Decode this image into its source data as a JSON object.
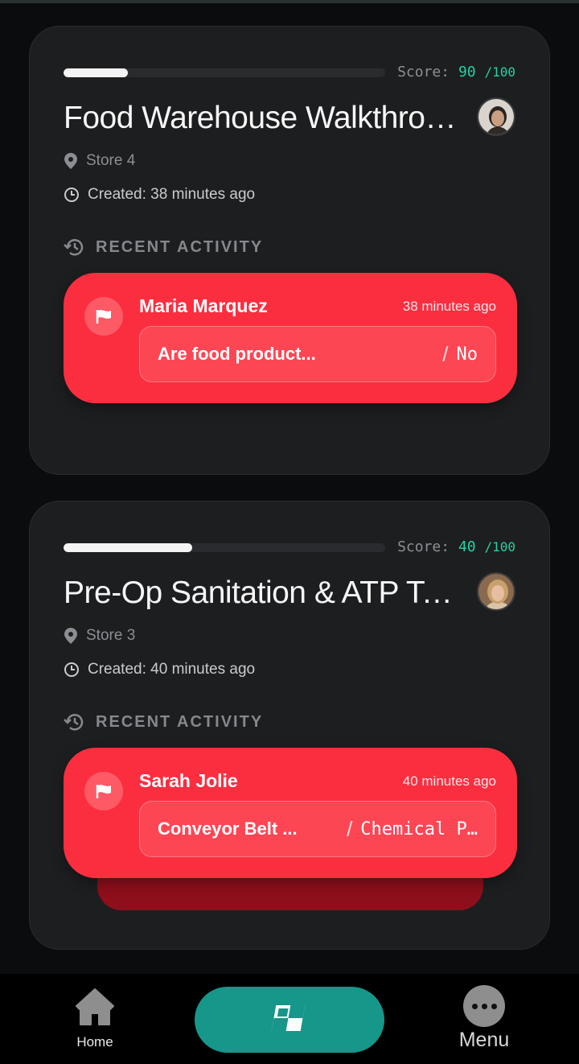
{
  "colors": {
    "background": "#0b0c0d",
    "card": "#1d1e20",
    "accent_score": "#1fd3a3",
    "flag_red": "#fb2e40",
    "nav_teal": "#17968a"
  },
  "audits": [
    {
      "progress": 0.2,
      "score_label": "Score:",
      "score_value": "90",
      "score_max": "/100",
      "title": "Food Warehouse Walkthrough",
      "location": "Store 4",
      "created": "Created: 38 minutes ago",
      "section_label": "RECENT ACTIVITY",
      "activity": {
        "user": "Maria Marquez",
        "time": "38 minutes ago",
        "question": "Are food product...",
        "answer": "No"
      }
    },
    {
      "progress": 0.4,
      "score_label": "Score:",
      "score_value": "40",
      "score_max": "/100",
      "title": "Pre-Op Sanitation & ATP Testing",
      "location": "Store 3",
      "created": "Created: 40 minutes ago",
      "section_label": "RECENT ACTIVITY",
      "activity": {
        "user": "Sarah Jolie",
        "time": "40 minutes ago",
        "question": "Conveyor Belt ...",
        "answer": "Chemical P…"
      }
    }
  ],
  "nav": {
    "home_label": "Home",
    "menu_label": "Menu",
    "icons": {
      "home": "home-icon",
      "center": "checkered-flag-icon",
      "menu": "more-dots-icon"
    }
  }
}
